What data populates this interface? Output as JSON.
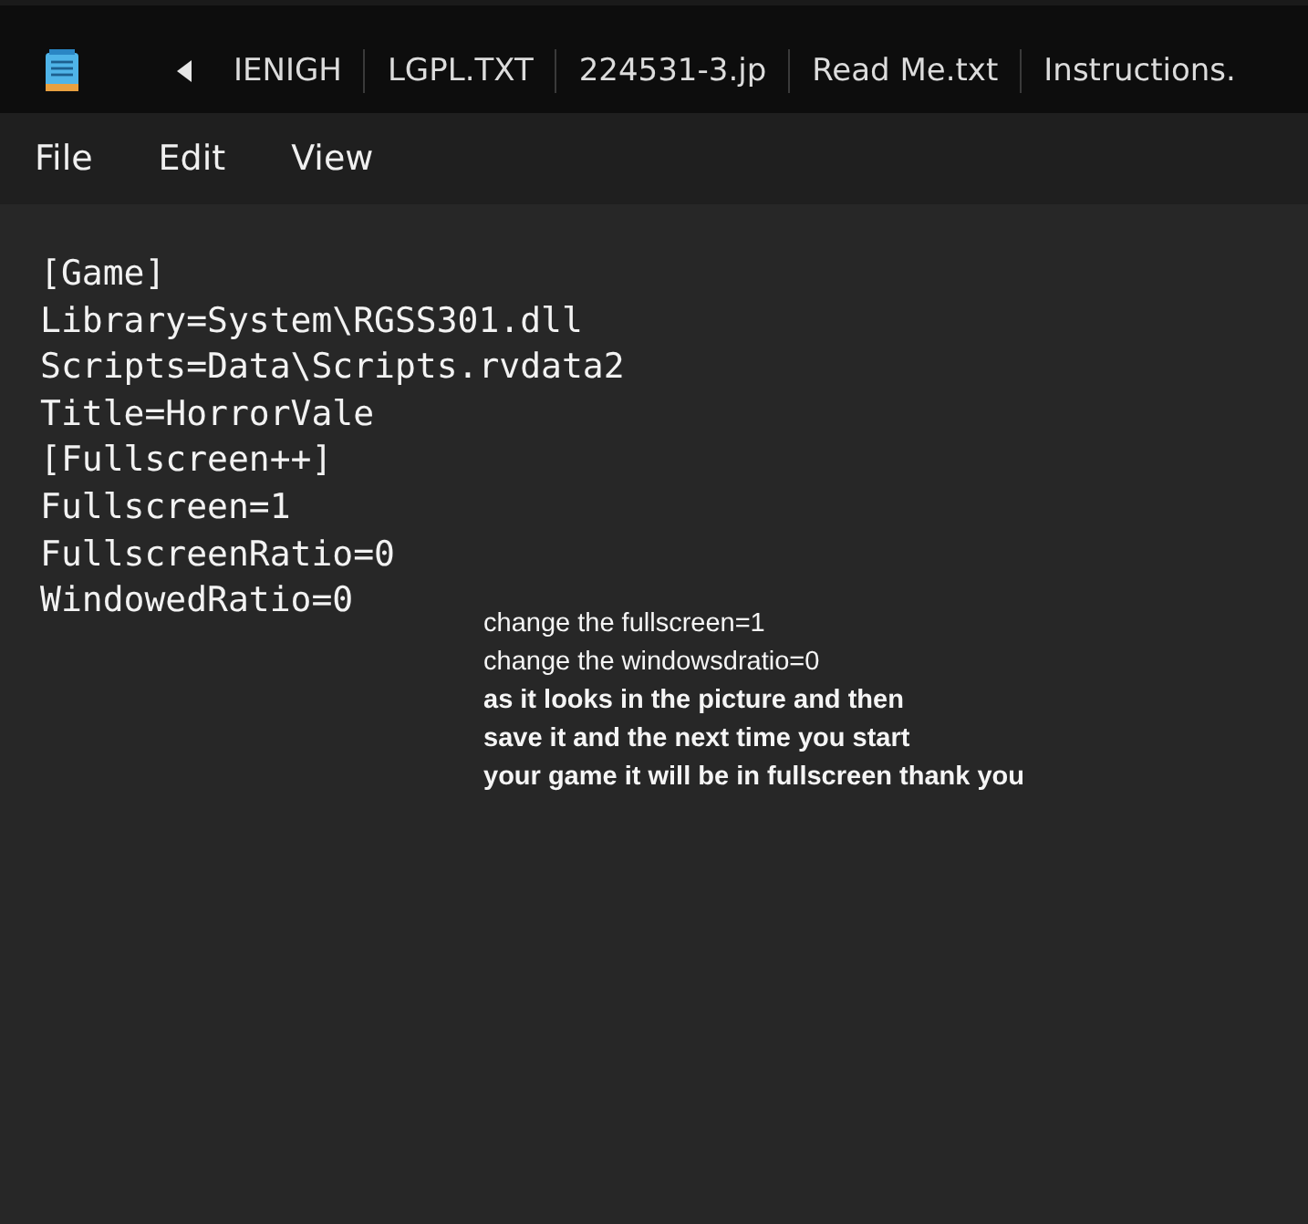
{
  "tabs": [
    {
      "label": "IENIGH"
    },
    {
      "label": "LGPL.TXT"
    },
    {
      "label": "224531-3.jp"
    },
    {
      "label": "Read Me.txt"
    },
    {
      "label": "Instructions."
    }
  ],
  "menu": [
    "File",
    "Edit",
    "View"
  ],
  "editor_lines": [
    "[Game]",
    "Library=System\\RGSS301.dll",
    "Scripts=Data\\Scripts.rvdata2",
    "Title=HorrorVale",
    "[Fullscreen++]",
    "Fullscreen=1",
    "FullscreenRatio=0",
    "WindowedRatio=0"
  ],
  "annotation": [
    {
      "text": "change the fullscreen=1",
      "bold": false
    },
    {
      "text": "change the windowsdratio=0",
      "bold": false
    },
    {
      "text": "as it looks in the picture and then",
      "bold": true
    },
    {
      "text": "save it and the next time you start",
      "bold": true
    },
    {
      "text": "your game it will be in fullscreen thank you",
      "bold": true
    }
  ]
}
